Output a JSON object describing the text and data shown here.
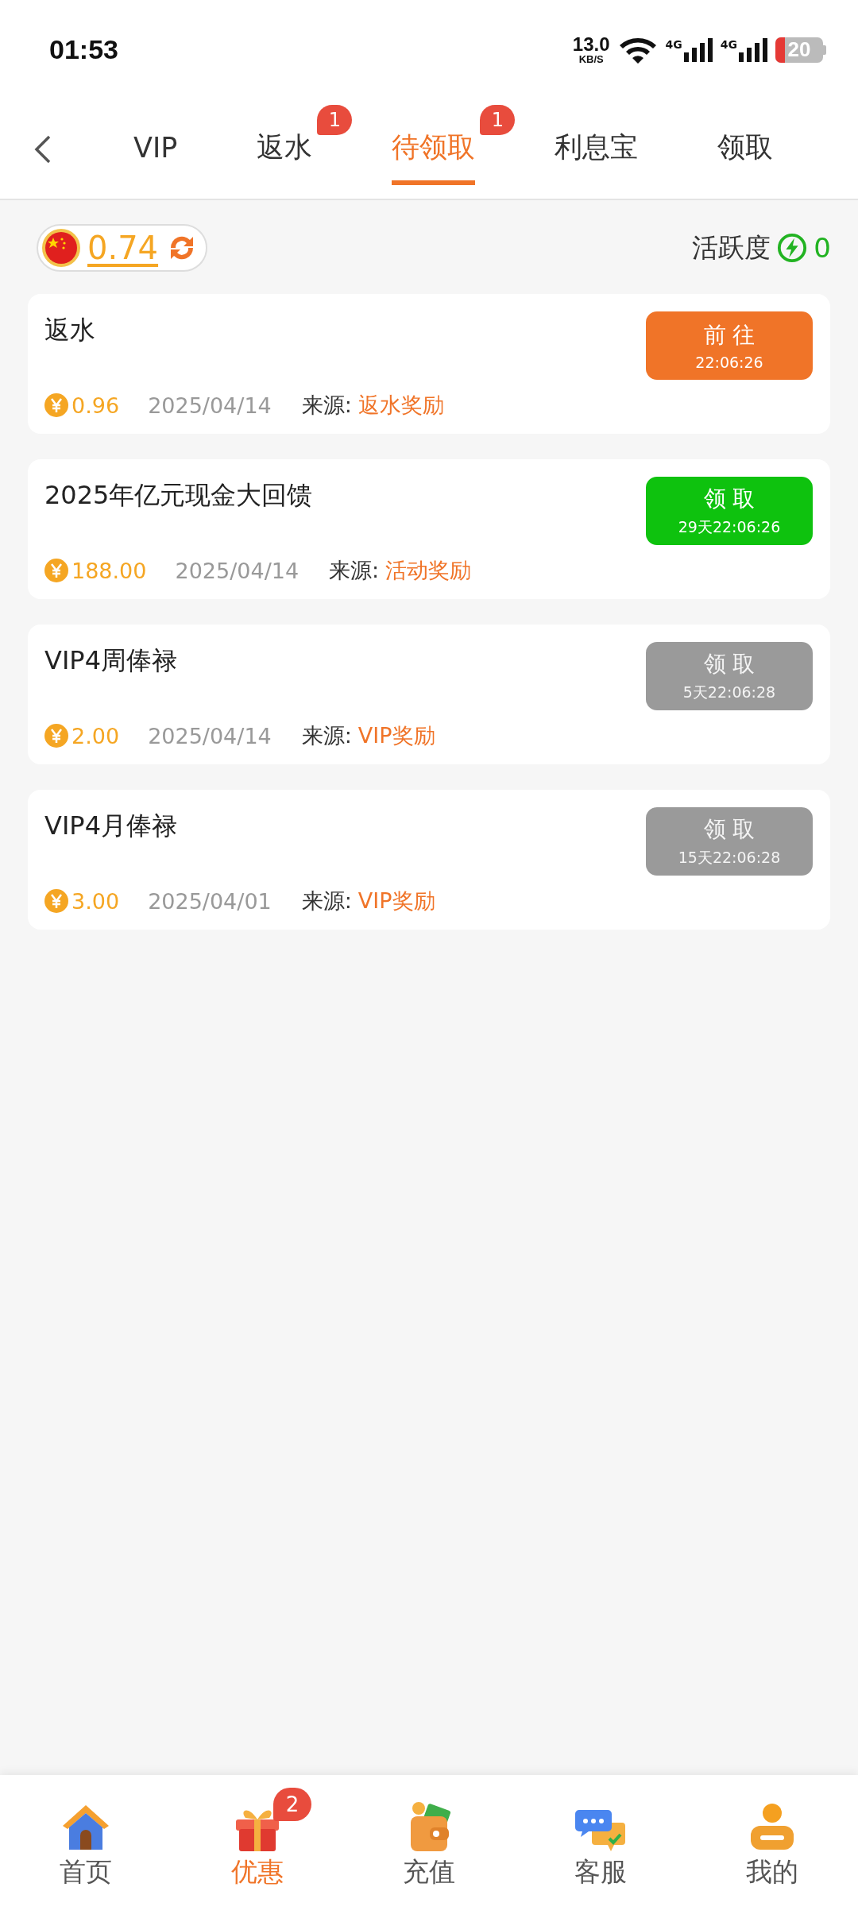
{
  "status_bar": {
    "time": "01:53",
    "net_speed": "13.0",
    "net_unit": "KB/S",
    "signal_1": "4G",
    "signal_2": "4G",
    "battery": "20"
  },
  "tabs": [
    {
      "label": "VIP",
      "selected": false
    },
    {
      "label": "返水",
      "selected": false,
      "badge": "1"
    },
    {
      "label": "待领取",
      "selected": true,
      "badge": "1"
    },
    {
      "label": "利息宝",
      "selected": false
    },
    {
      "label": "领取",
      "selected": false
    }
  ],
  "balance": {
    "amount": "0.74"
  },
  "activity": {
    "label": "活跃度",
    "value": "0"
  },
  "rewards": [
    {
      "title": "返水",
      "amount": "0.96",
      "date": "2025/04/14",
      "source_label": "来源:",
      "source": "返水奖励",
      "button": {
        "kind": "go",
        "label": "前 往",
        "timer": "22:06:26",
        "disabled": false
      }
    },
    {
      "title": "2025年亿元现金大回馈",
      "amount": "188.00",
      "date": "2025/04/14",
      "source_label": "来源:",
      "source": "活动奖励",
      "button": {
        "kind": "claim",
        "label": "领 取",
        "timer": "29天22:06:26",
        "disabled": false
      }
    },
    {
      "title": "VIP4周俸禄",
      "amount": "2.00",
      "date": "2025/04/14",
      "source_label": "来源:",
      "source": "VIP奖励",
      "button": {
        "kind": "claim",
        "label": "领 取",
        "timer": "5天22:06:28",
        "disabled": true
      }
    },
    {
      "title": "VIP4月俸禄",
      "amount": "3.00",
      "date": "2025/04/01",
      "source_label": "来源:",
      "source": "VIP奖励",
      "button": {
        "kind": "claim",
        "label": "领 取",
        "timer": "15天22:06:28",
        "disabled": true
      }
    }
  ],
  "nav": [
    {
      "kind": "home",
      "label": "首页",
      "selected": false
    },
    {
      "kind": "gift",
      "label": "优惠",
      "selected": true,
      "badge": "2"
    },
    {
      "kind": "wallet",
      "label": "充值",
      "selected": false
    },
    {
      "kind": "chat",
      "label": "客服",
      "selected": false
    },
    {
      "kind": "user",
      "label": "我的",
      "selected": false
    }
  ]
}
